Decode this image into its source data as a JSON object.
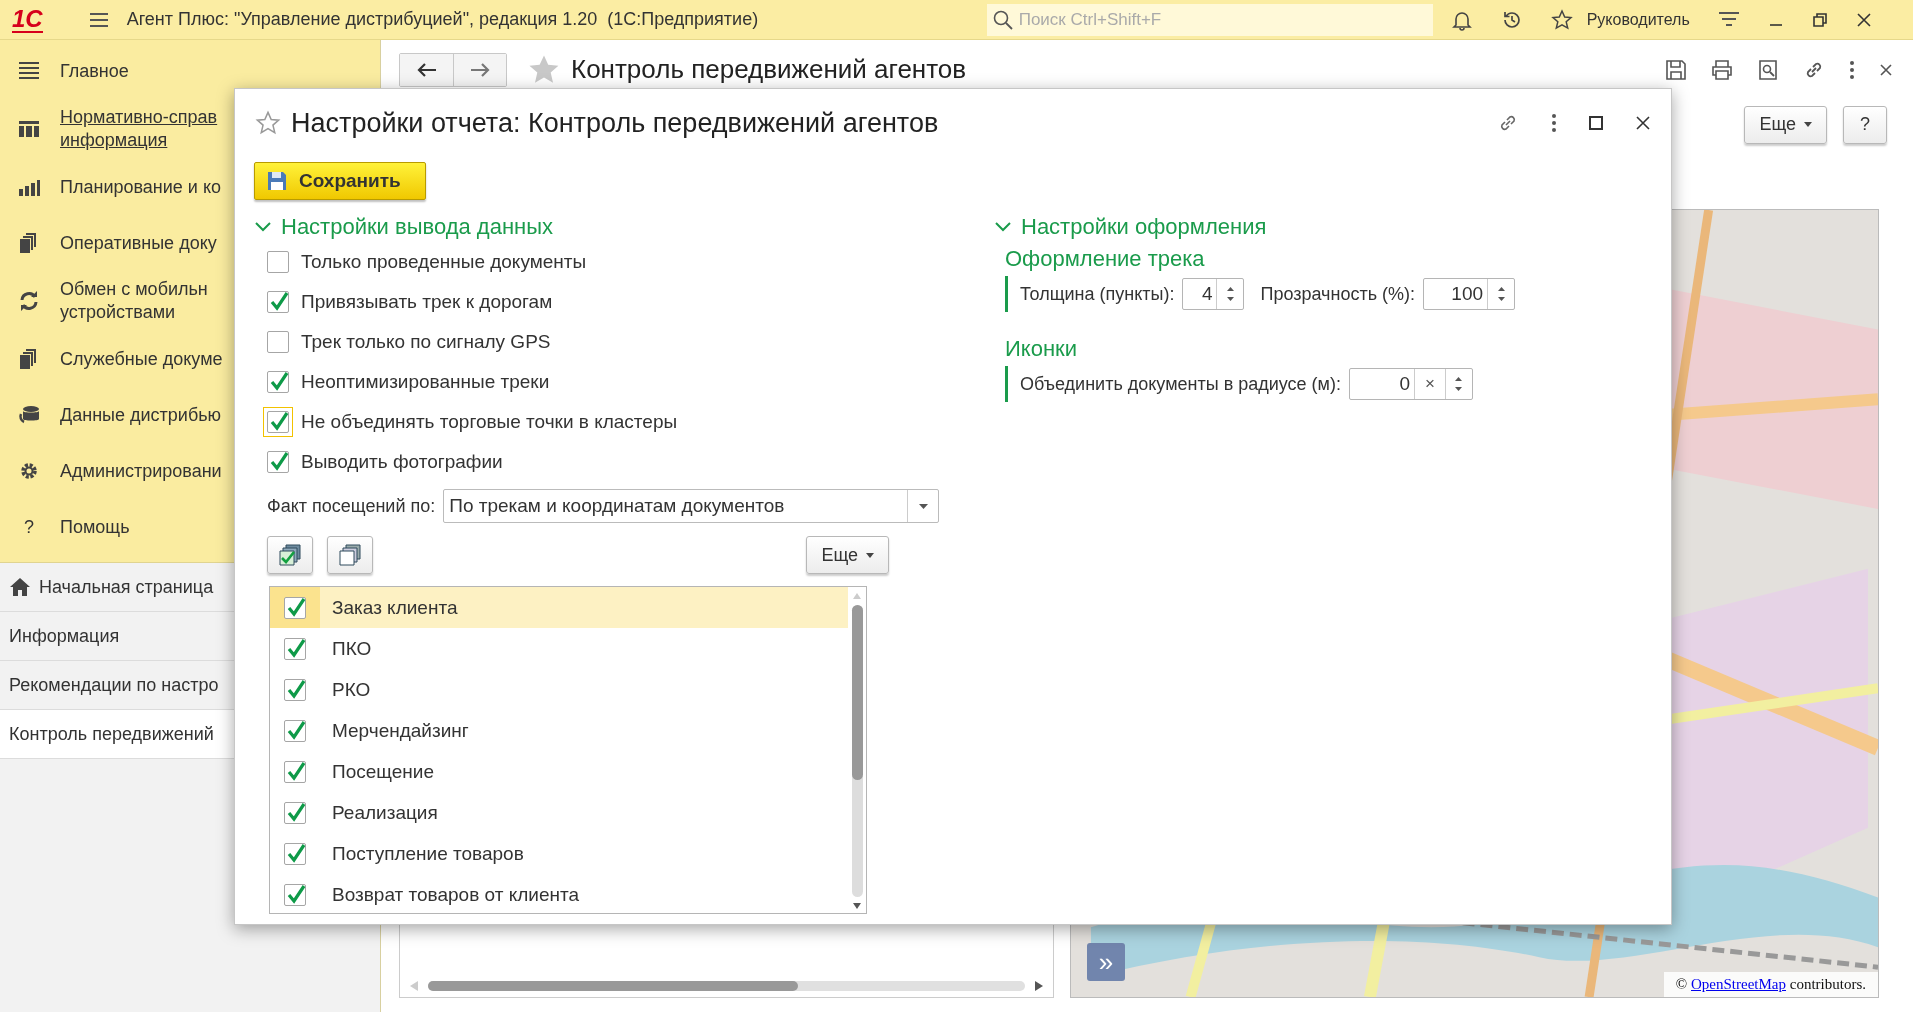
{
  "app_bar": {
    "logo": "1С",
    "title": "Агент Плюс: \"Управление дистрибуцией\", редакция 1.20  (1С:Предприятие)",
    "search": {
      "placeholder": "Поиск Ctrl+Shift+F"
    },
    "user": "Руководитель"
  },
  "sidebar": {
    "sections": [
      {
        "label": "Главное",
        "hovered": false
      },
      {
        "label": "Нормативно-справ\nинформация",
        "hovered": true
      },
      {
        "label": "Планирование и ко",
        "hovered": false
      },
      {
        "label": "Оперативные доку",
        "hovered": false
      },
      {
        "label": "Обмен с мобильн\nустройствами",
        "hovered": false
      },
      {
        "label": "Служебные докуме",
        "hovered": false
      },
      {
        "label": "Данные дистрибью",
        "hovered": false
      },
      {
        "label": "Администрировани",
        "hovered": false
      },
      {
        "label": "Помощь",
        "hovered": false,
        "glyph": "?"
      }
    ],
    "open_windows": [
      {
        "label": "Начальная страница",
        "kind": "home",
        "selected": false
      },
      {
        "label": "Информация",
        "kind": "plain",
        "selected": false
      },
      {
        "label": "Рекомендации по настро",
        "kind": "plain",
        "selected": false
      },
      {
        "label": "Контроль передвижений",
        "kind": "plain",
        "selected": true
      }
    ]
  },
  "report": {
    "title": "Контроль передвижений агентов",
    "more_button": "Еще",
    "help_button": "?",
    "map": {
      "expand_button": "»",
      "attribution_prefix": "©",
      "attribution_link": "OpenStreetMap",
      "attribution_suffix": "contributors."
    }
  },
  "dialog": {
    "title": "Настройки отчета: Контроль передвижений агентов",
    "save_button": "Сохранить",
    "output_section": {
      "title": "Настройки вывода данных",
      "expanded": true,
      "options": [
        {
          "label": "Только проведенные документы",
          "checked": false,
          "focused": false
        },
        {
          "label": "Привязывать трек к дорогам",
          "checked": true,
          "focused": false
        },
        {
          "label": "Трек только по сигналу GPS",
          "checked": false,
          "focused": false
        },
        {
          "label": "Неоптимизированные треки",
          "checked": true,
          "focused": false
        },
        {
          "label": "Не объединять торговые точки в кластеры",
          "checked": true,
          "focused": true
        },
        {
          "label": "Выводить фотографии",
          "checked": true,
          "focused": false
        }
      ],
      "visit_fact": {
        "label": "Факт посещений по:",
        "value": "По трекам и координатам документов"
      },
      "more_button": "Еще",
      "document_types": [
        {
          "label": "Заказ клиента",
          "checked": true,
          "selected": true
        },
        {
          "label": "ПКО",
          "checked": true,
          "selected": false
        },
        {
          "label": "РКО",
          "checked": true,
          "selected": false
        },
        {
          "label": "Мерчендайзинг",
          "checked": true,
          "selected": false
        },
        {
          "label": "Посещение",
          "checked": true,
          "selected": false
        },
        {
          "label": "Реализация",
          "checked": true,
          "selected": false
        },
        {
          "label": "Поступление товаров",
          "checked": true,
          "selected": false
        },
        {
          "label": "Возврат товаров от клиента",
          "checked": true,
          "selected": false
        }
      ]
    },
    "appearance_section": {
      "title": "Настройки оформления",
      "expanded": true,
      "track_group": {
        "title": "Оформление трека",
        "thickness_label": "Толщина (пункты):",
        "thickness": "4",
        "opacity_label": "Прозрачность (%):",
        "opacity": "100"
      },
      "icons_group": {
        "title": "Иконки",
        "radius_label": "Объединить документы в радиусе (м):",
        "radius": "0",
        "clear_button": "×"
      }
    }
  }
}
